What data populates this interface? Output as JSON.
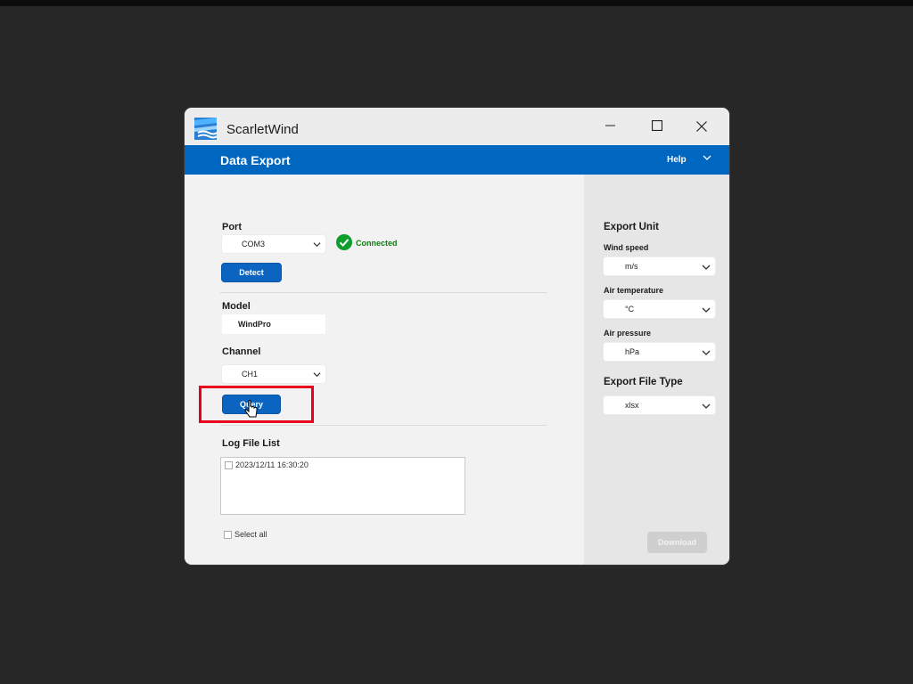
{
  "app": {
    "title": "ScarletWind"
  },
  "header": {
    "title": "Data Export",
    "help_label": "Help"
  },
  "port": {
    "label": "Port",
    "selected": "COM3",
    "status": "Connected",
    "detect_label": "Detect"
  },
  "model": {
    "label": "Model",
    "value": "WindPro"
  },
  "channel": {
    "label": "Channel",
    "selected": "CH1",
    "query_label": "Query"
  },
  "log_files": {
    "label": "Log File List",
    "items": [
      "2023/12/11 16:30:20"
    ],
    "select_all_label": "Select all"
  },
  "export_unit": {
    "title": "Export Unit",
    "wind_speed": {
      "label": "Wind speed",
      "value": "m/s"
    },
    "air_temperature": {
      "label": "Air temperature",
      "value": "°C"
    },
    "air_pressure": {
      "label": "Air pressure",
      "value": "hPa"
    }
  },
  "export_file_type": {
    "title": "Export File Type",
    "value": "xlsx"
  },
  "download_label": "Download",
  "colors": {
    "accent": "#0067c0",
    "status_ok": "#0f7b0f",
    "highlight": "#e8001c"
  }
}
